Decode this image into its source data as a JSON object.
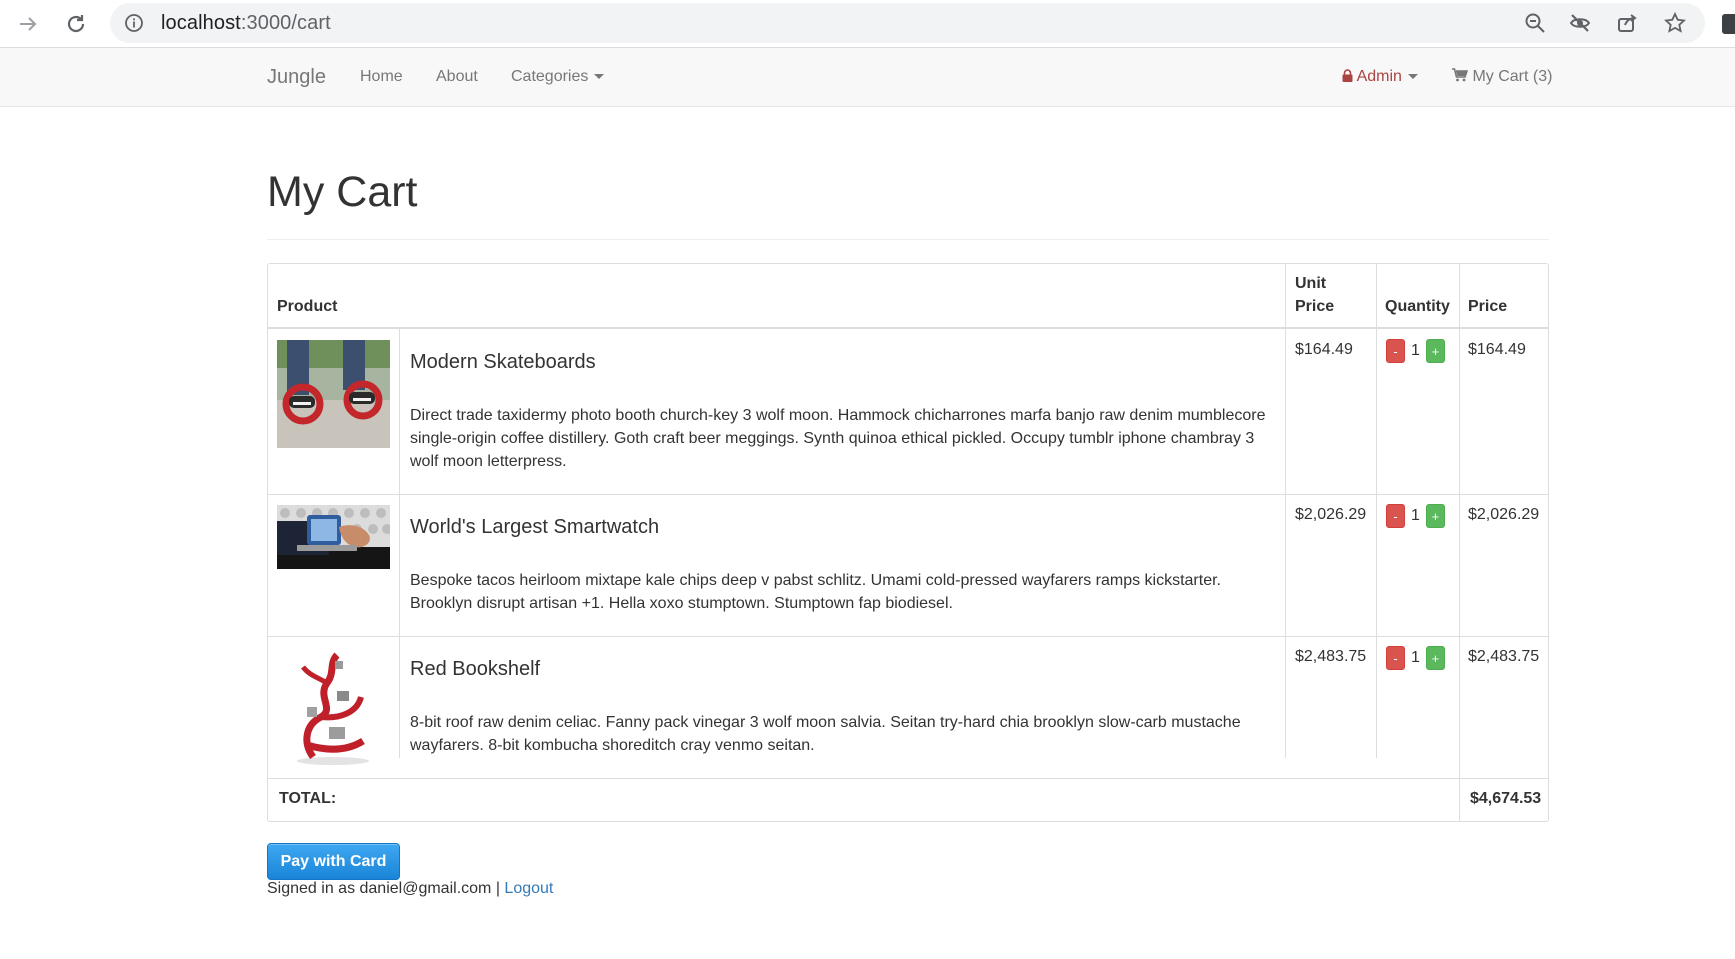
{
  "browser": {
    "url_host": "localhost",
    "url_path": ":3000/cart"
  },
  "navbar": {
    "brand": "Jungle",
    "links": [
      "Home",
      "About",
      "Categories"
    ],
    "admin_label": "Admin",
    "cart_label": "My Cart (3)"
  },
  "page": {
    "title": "My Cart"
  },
  "table": {
    "headers": {
      "product": "Product",
      "unit_price_line1": "Unit",
      "unit_price_line2": "Price",
      "quantity": "Quantity",
      "price": "Price"
    },
    "rows": [
      {
        "name": "Modern Skateboards",
        "description": "Direct trade taxidermy photo booth church-key 3 wolf moon. Hammock chicharrones marfa banjo raw denim mumblecore single-origin coffee distillery. Goth craft beer meggings. Synth quinoa ethical pickled. Occupy tumblr iphone chambray 3 wolf moon letterpress.",
        "unit_price": "$164.49",
        "quantity": "1",
        "price": "$164.49",
        "image": "skateboards-photo"
      },
      {
        "name": "World's Largest Smartwatch",
        "description": "Bespoke tacos heirloom mixtape kale chips deep v pabst schlitz. Umami cold-pressed wayfarers ramps kickstarter. Brooklyn disrupt artisan +1. Hella xoxo stumptown. Stumptown fap biodiesel.",
        "unit_price": "$2,026.29",
        "quantity": "1",
        "price": "$2,026.29",
        "image": "smartwatch-photo"
      },
      {
        "name": "Red Bookshelf",
        "description": "8-bit roof raw denim celiac. Fanny pack vinegar 3 wolf moon salvia. Seitan try-hard chia brooklyn slow-carb mustache wayfarers. 8-bit kombucha shoreditch cray venmo seitan.",
        "unit_price": "$2,483.75",
        "quantity": "1",
        "price": "$2,483.75",
        "image": "bookshelf-photo"
      }
    ],
    "minus_label": "-",
    "plus_label": "+",
    "total_label": "TOTAL:",
    "total_value": "$4,674.53"
  },
  "footer": {
    "pay_button": "Pay with Card",
    "signed_in_text": "Signed in as daniel@gmail.com",
    "separator": "|",
    "logout_label": "Logout"
  },
  "colors": {
    "accent_link": "#337ab7",
    "danger": "#d9534f",
    "success": "#5cb85c",
    "admin": "#a94442",
    "pay_button": "#1f8ceb"
  }
}
